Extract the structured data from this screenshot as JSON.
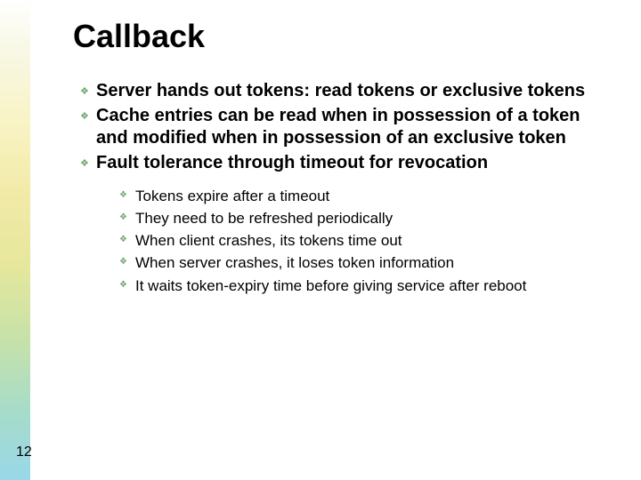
{
  "title": "Callback",
  "bullets": [
    "Server hands out tokens: read tokens or exclusive tokens",
    "Cache entries can be read when in possession of a token and  modified when in possession of an exclusive token",
    "Fault tolerance through timeout for revocation"
  ],
  "sub_bullets": [
    "Tokens expire after a timeout",
    "They need to be refreshed periodically",
    "When client crashes, its tokens time out",
    "When server crashes, it loses token information",
    "It waits token-expiry time before giving service after reboot"
  ],
  "page_number": "12",
  "icons": {
    "diamond": "❖"
  }
}
